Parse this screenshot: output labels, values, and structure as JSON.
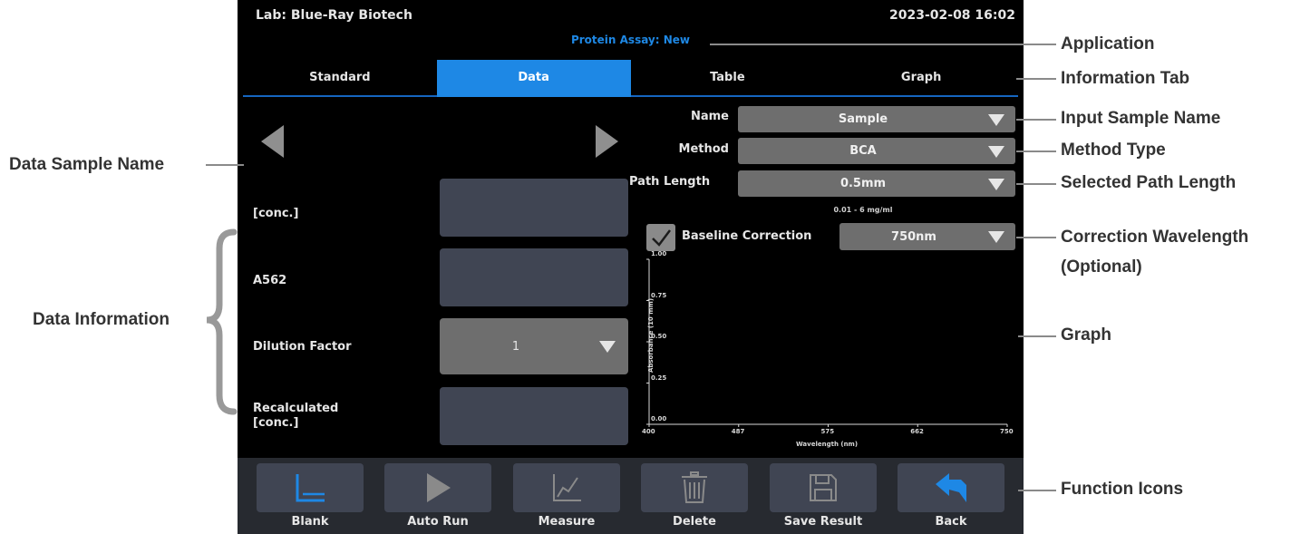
{
  "header": {
    "lab": "Lab: Blue-Ray Biotech",
    "datetime": "2023-02-08 16:02",
    "application": "Protein Assay: New"
  },
  "tabs": [
    {
      "label": "Standard",
      "active": false
    },
    {
      "label": "Data",
      "active": true
    },
    {
      "label": "Table",
      "active": false
    },
    {
      "label": "Graph",
      "active": false
    }
  ],
  "data_fields": {
    "conc_label": "[conc.]",
    "a562_label": "A562",
    "dilution_label": "Dilution Factor",
    "dilution_value": "1",
    "recalc_label": "Recalculated\n[conc.]"
  },
  "settings": {
    "name_label": "Name",
    "name_value": "Sample",
    "method_label": "Method",
    "method_value": "BCA",
    "path_label": "Path Length",
    "path_value": "0.5mm",
    "range_note": "0.01 - 6 mg/ml",
    "baseline_label": "Baseline Correction",
    "baseline_checked": true,
    "baseline_value": "750nm"
  },
  "chart_data": {
    "type": "line",
    "xlabel": "Wavelength (nm)",
    "ylabel": "Absorbance (10 mm)",
    "x_ticks": [
      "400",
      "487",
      "575",
      "662",
      "750"
    ],
    "y_ticks": [
      "0.00",
      "0.25",
      "0.50",
      "0.75",
      "1.00"
    ],
    "xlim": [
      400,
      750
    ],
    "ylim": [
      0,
      1
    ],
    "series": []
  },
  "functions": [
    {
      "label": "Blank",
      "icon": "blank-axis-icon"
    },
    {
      "label": "Auto Run",
      "icon": "play-icon"
    },
    {
      "label": "Measure",
      "icon": "measure-chart-icon"
    },
    {
      "label": "Delete",
      "icon": "trash-icon"
    },
    {
      "label": "Save Result",
      "icon": "save-icon"
    },
    {
      "label": "Back",
      "icon": "back-arrow-icon"
    }
  ],
  "annotations": {
    "application": "Application",
    "information_tab": "Information Tab",
    "input_sample_name": "Input Sample Name",
    "method_type": "Method Type",
    "selected_path_length": "Selected Path Length",
    "correction_wavelength_1": "Correction Wavelength",
    "correction_wavelength_2": "(Optional)",
    "graph": "Graph",
    "function_icons": "Function Icons",
    "data_sample_name": "Data Sample Name",
    "data_information": "Data Information"
  },
  "colors": {
    "accent": "#1e88e5",
    "panel_bg": "#000000",
    "field_bg": "#404553",
    "select_bg": "#6e6e6e",
    "function_blue": "#1e88e5"
  }
}
